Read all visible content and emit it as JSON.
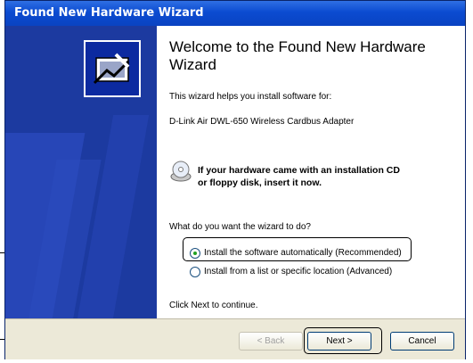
{
  "window": {
    "title": "Found New Hardware Wizard"
  },
  "content": {
    "heading": "Welcome to the Found New Hardware Wizard",
    "intro": "This wizard helps you install software for:",
    "device": "D-Link Air DWL-650  Wireless Cardbus Adapter",
    "cd_prompt_line1": "If your hardware came with an installation CD",
    "cd_prompt_line2": "or floppy disk, insert it now.",
    "question": "What do you want the wizard to do?",
    "option_auto": "Install the software automatically (Recommended)",
    "option_list": "Install from a list or specific location (Advanced)",
    "option_selected": "auto",
    "continue_hint": "Click Next to continue."
  },
  "buttons": {
    "back": "< Back",
    "next": "Next >",
    "cancel": "Cancel"
  },
  "colors": {
    "titlebar": "#0b4bd1",
    "sidebar": "#1c3aa0",
    "dialog_bg": "#ece9d8"
  },
  "icons": {
    "wizard": "hardware-wizard-icon",
    "cd": "cd-disk-icon"
  }
}
